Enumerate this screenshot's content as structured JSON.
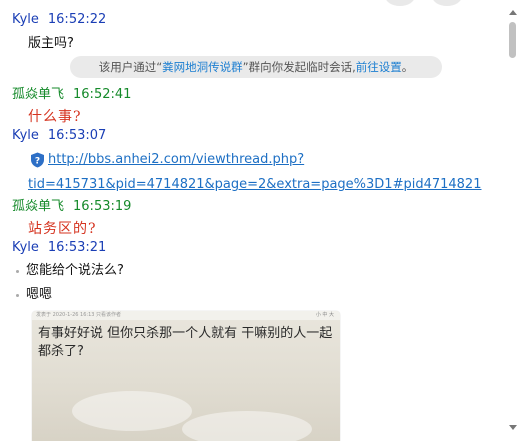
{
  "messages": [
    {
      "sender": "Kyle",
      "time": "16:52:22",
      "text": "版主吗?"
    },
    {
      "sender": "孤焱单飞",
      "time": "16:52:41",
      "text": "什么事?"
    },
    {
      "sender": "Kyle",
      "time": "16:53:07",
      "link_line1": "http://bbs.anhei2.com/viewthread.php?",
      "link_line2": "tid=415731&pid=4714821&page=2&extra=page%3D1#pid4714821"
    },
    {
      "sender": "孤焱单飞",
      "time": "16:53:19",
      "text": "站务区的?"
    },
    {
      "sender": "Kyle",
      "time": "16:53:21",
      "bullet1": "您能给个说法么?",
      "bullet2": "嗯嗯"
    }
  ],
  "system_notice": {
    "prefix": "该用户通过“",
    "group_name": "粪网地洞传说群",
    "middle": "”群向你发起临时会话,",
    "link": "前往设置",
    "suffix": "。"
  },
  "image_preview": {
    "header_left": "发表于 2020-1-26 16:13 只看该作者",
    "header_right": "小 中 大",
    "text": "有事好好说 但你只杀那一个人就有 干嘛别的人一起都杀了?"
  },
  "colors": {
    "self_sender": "#1a3eb5",
    "other_sender": "#158a2a",
    "red_text": "#d5331f",
    "link": "#1d6fc4",
    "notice_bg": "#eaeaea"
  },
  "icons": {
    "link_security": "shield-question-icon",
    "scroll_up": "triangle-up-icon",
    "scroll_down": "triangle-down-icon"
  }
}
